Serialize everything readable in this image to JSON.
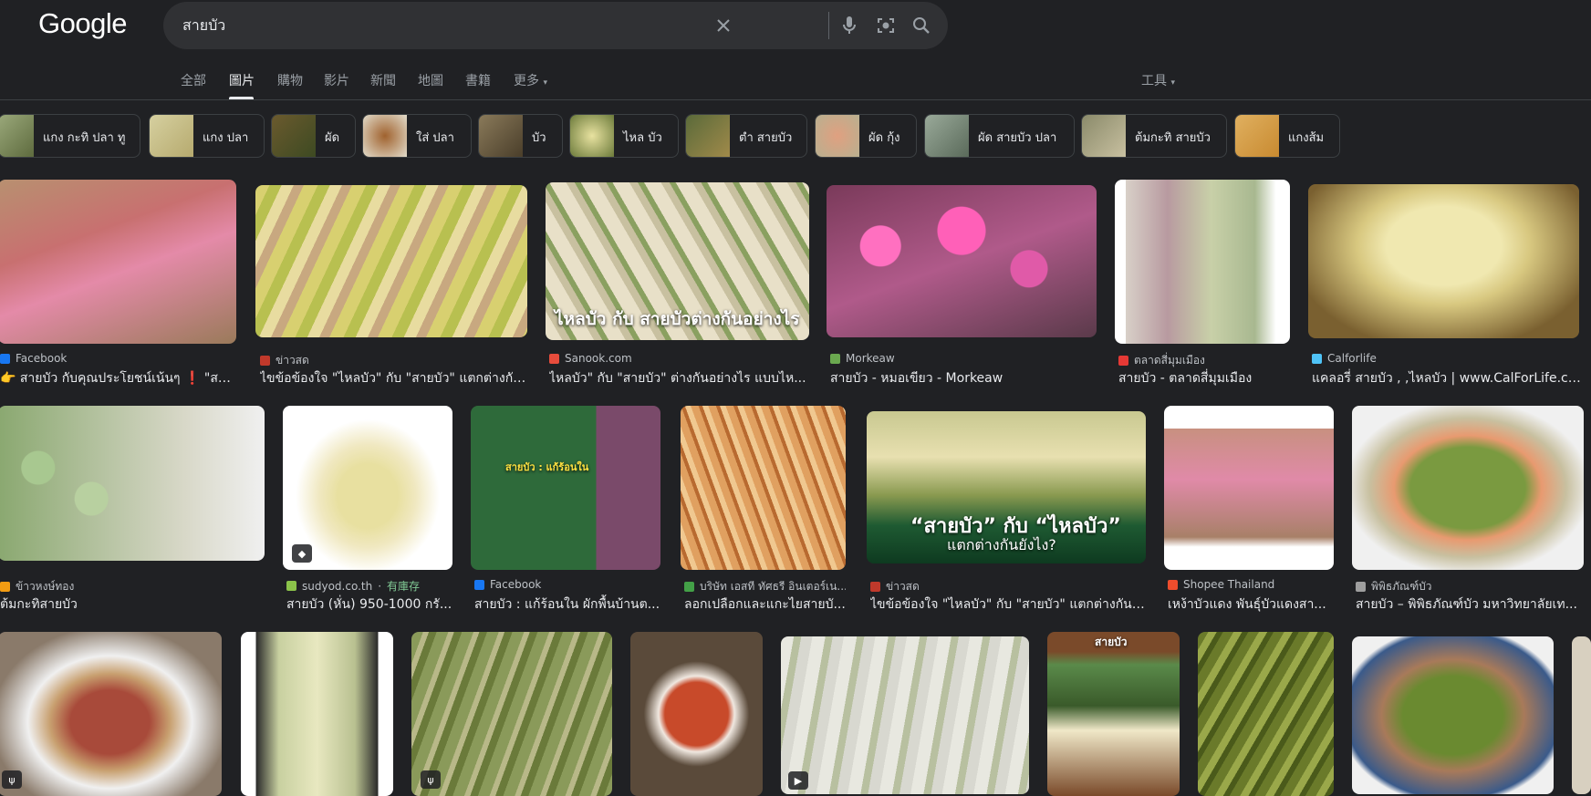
{
  "logo": "Google",
  "search": {
    "query": "สายบัว"
  },
  "tabs": [
    "全部",
    "圖片",
    "購物",
    "影片",
    "新聞",
    "地圖",
    "書籍",
    "更多"
  ],
  "tools_label": "工具",
  "chips": [
    "แกง กะทิ ปลา ทู",
    "แกง ปลา",
    "ผัด",
    "ใส่ ปลา",
    "บัว",
    "ไหล บัว",
    "ตำ สายบัว",
    "ผัด กุ้ง",
    "ผัด สายบัว ปลา",
    "ต้มกะทิ สายบัว",
    "แกงส้ม"
  ],
  "row1": [
    {
      "source": "Facebook",
      "title": "👉 สายบัว กับคุณประโยชน์เน้นๆ ❗ \"สาย..."
    },
    {
      "source": "ข่าวสด",
      "title": "ไขข้อข้องใจ \"ไหลบัว\" กับ \"สายบัว\" แตกต่างกัน..."
    },
    {
      "source": "Sanook.com",
      "title": "ไหลบัว\" กับ \"สายบัว\" ต่างกันอย่างไร แบบไห...",
      "overlay": "ไหลบัว กับ สายบัวต่างกันอย่างไร"
    },
    {
      "source": "Morkeaw",
      "title": "สายบัว - หมอเขียว - Morkeaw"
    },
    {
      "source": "ตลาดสี่มุมเมือง",
      "title": "สายบัว - ตลาดสี่มุมเมือง"
    },
    {
      "source": "Calforlife",
      "title": "แคลอรี่ สายบัว , ,ไหลบัว | www.CalForLife.com"
    }
  ],
  "row2": [
    {
      "source": "ข้าวหงษ์ทอง",
      "title": "ต้มกะทิสายบัว"
    },
    {
      "source": "sudyod.co.th",
      "stock": "有庫存",
      "title": "สายบัว (หั่น) 950-1000 กรั..."
    },
    {
      "source": "Facebook",
      "title": "สายบัว : แก้ร้อนใน ผักพื้นบ้านต..."
    },
    {
      "source": "บริษัท เอสที ทัศธรี อินเตอร์เน...",
      "title": "ลอกเปลือกและแกะไยสายบั..."
    },
    {
      "source": "ข่าวสด",
      "title": "ไขข้อข้องใจ \"ไหลบัว\" กับ \"สายบัว\" แตกต่างกันยั...",
      "overlay1": "“สายบัว” กับ “ไหลบัว”",
      "overlay2": "แตกต่างกันยังไง?"
    },
    {
      "source": "Shopee Thailand",
      "title": "เหง้าบัวแดง พันธุ์บัวแดงสา..."
    },
    {
      "source": "พิพิธภัณฑ์บัว",
      "title": "สายบัว – พิพิธภัณฑ์บัว มหาวิทยาลัยเท..."
    }
  ],
  "colors": {
    "bg": "#202124",
    "searchbar": "#303134",
    "text": "#e8eaed",
    "muted": "#9aa0a6"
  }
}
